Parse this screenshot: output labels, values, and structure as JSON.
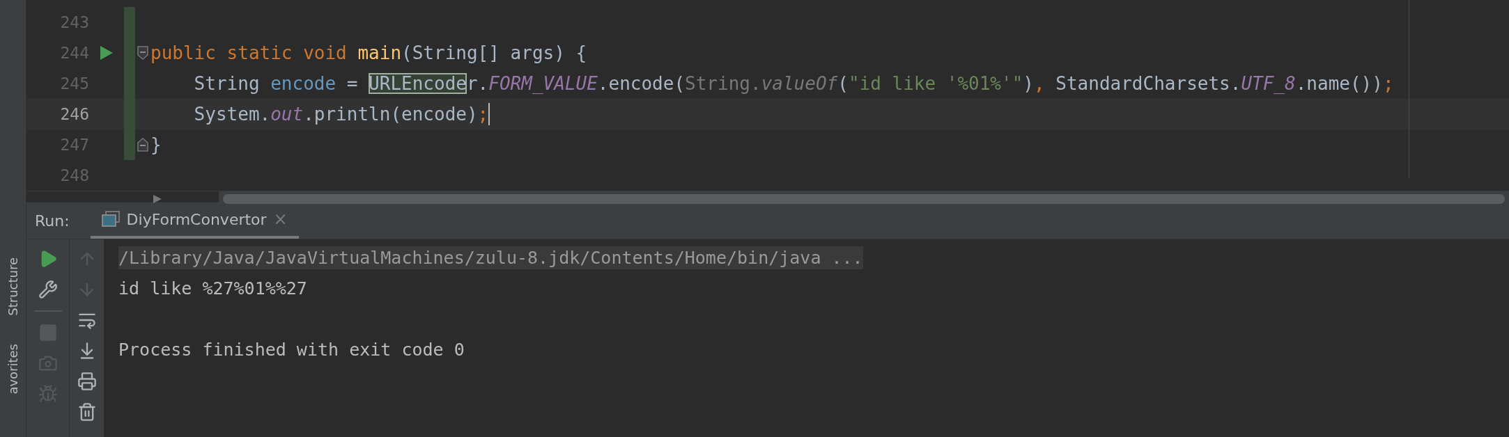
{
  "side_tabs": [
    {
      "label": "Structure"
    },
    {
      "label": "avorites"
    }
  ],
  "editor": {
    "lines": [
      {
        "number": "243",
        "current": false,
        "changed": true
      },
      {
        "number": "244",
        "current": false,
        "changed": true,
        "markers": [
          {
            "kind": "run"
          },
          {
            "kind": "fold-start"
          }
        ],
        "tokens": [
          {
            "text": "public static void ",
            "kind": "keyword"
          },
          {
            "text": "main",
            "kind": "function"
          },
          {
            "text": "(String[] args) {",
            "kind": "plain"
          }
        ]
      },
      {
        "number": "245",
        "current": false,
        "changed": true,
        "tokens": [
          {
            "text": "    String ",
            "kind": "plain"
          },
          {
            "text": "encode",
            "kind": "local"
          },
          {
            "text": " = ",
            "kind": "plain"
          },
          {
            "text": "URLEncode",
            "kind": "highlight"
          },
          {
            "text": "r.",
            "kind": "plain"
          },
          {
            "text": "FORM_VALUE",
            "kind": "field"
          },
          {
            "text": ".encode(",
            "kind": "plain"
          },
          {
            "text": "String.",
            "kind": "muted"
          },
          {
            "text": "valueOf",
            "kind": "muted-italic"
          },
          {
            "text": "(",
            "kind": "plain"
          },
          {
            "text": "\"id like '%01%'\"",
            "kind": "string"
          },
          {
            "text": ")",
            "kind": "plain"
          },
          {
            "text": ", ",
            "kind": "punct"
          },
          {
            "text": "StandardCharsets.",
            "kind": "plain"
          },
          {
            "text": "UTF_8",
            "kind": "field"
          },
          {
            "text": ".name())",
            "kind": "plain"
          },
          {
            "text": ";",
            "kind": "punct"
          }
        ]
      },
      {
        "number": "246",
        "current": true,
        "changed": true,
        "caret": true,
        "tokens": [
          {
            "text": "    System.",
            "kind": "plain"
          },
          {
            "text": "out",
            "kind": "field"
          },
          {
            "text": ".println(encode)",
            "kind": "plain"
          },
          {
            "text": ";",
            "kind": "punct"
          }
        ]
      },
      {
        "number": "247",
        "current": false,
        "changed": true,
        "markers": [
          {
            "kind": "fold-end"
          }
        ],
        "tokens": [
          {
            "text": "}",
            "kind": "plain"
          }
        ]
      },
      {
        "number": "248",
        "current": false,
        "changed": false
      }
    ]
  },
  "run_panel": {
    "label": "Run:",
    "tabs": [
      {
        "label": "DiyFormConvertor",
        "selected": true,
        "close": "×"
      }
    ],
    "tools_left": [
      {
        "kind": "run",
        "disabled": false
      },
      {
        "kind": "wrench",
        "disabled": false
      },
      {
        "kind": "separator"
      },
      {
        "kind": "stop",
        "disabled": true
      },
      {
        "kind": "camera",
        "disabled": true
      },
      {
        "kind": "bug",
        "disabled": true
      }
    ],
    "tools_right": [
      {
        "kind": "up",
        "disabled": true
      },
      {
        "kind": "down",
        "disabled": true
      },
      {
        "kind": "wrap",
        "disabled": false
      },
      {
        "kind": "scroll-end",
        "disabled": false
      },
      {
        "kind": "print",
        "disabled": false
      },
      {
        "kind": "trash",
        "disabled": false
      }
    ],
    "console": [
      {
        "text": "/Library/Java/JavaVirtualMachines/zulu-8.jdk/Contents/Home/bin/java ...",
        "kind": "command"
      },
      {
        "text": "id like %27%01%%27",
        "kind": "output"
      },
      {
        "kind": "blank"
      },
      {
        "text": "Process finished with exit code 0",
        "kind": "output"
      }
    ]
  }
}
